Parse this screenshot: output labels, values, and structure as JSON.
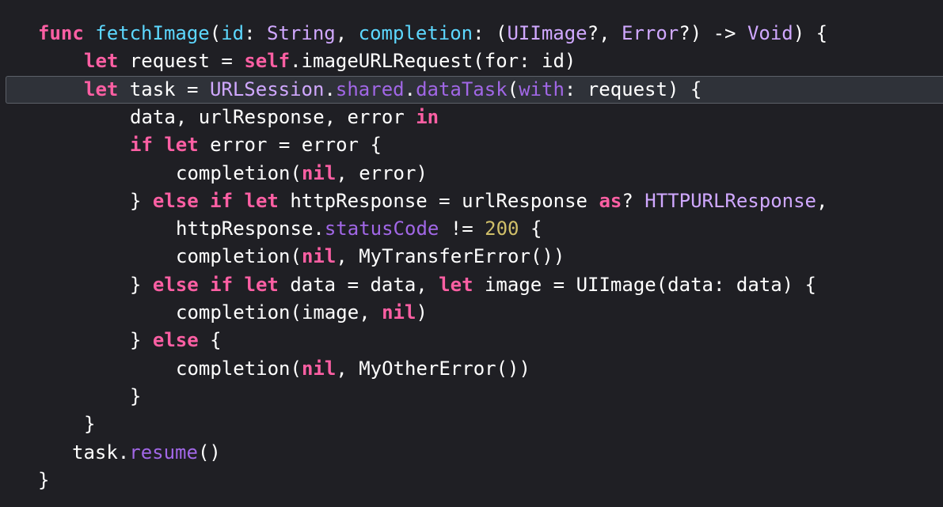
{
  "editor": {
    "language": "swift",
    "current_line": 2,
    "colors": {
      "background": "#1f1f24",
      "current_line": "#2f3239",
      "keyword": "#fc5fa3",
      "declaration": "#5dd8ff",
      "type": "#d0a8ff",
      "property": "#a167e6",
      "number": "#d0bf69",
      "plain": "#ffffff"
    },
    "lines": [
      {
        "indent": 0,
        "tokens": [
          {
            "t": "func",
            "k": "kw"
          },
          {
            "t": " ",
            "k": "pl"
          },
          {
            "t": "fetchImage",
            "k": "fn"
          },
          {
            "t": "(",
            "k": "pl"
          },
          {
            "t": "id",
            "k": "fn"
          },
          {
            "t": ": ",
            "k": "pl"
          },
          {
            "t": "String",
            "k": "typ"
          },
          {
            "t": ", ",
            "k": "pl"
          },
          {
            "t": "completion",
            "k": "fn"
          },
          {
            "t": ": (",
            "k": "pl"
          },
          {
            "t": "UIImage",
            "k": "typ"
          },
          {
            "t": "?, ",
            "k": "pl"
          },
          {
            "t": "Error",
            "k": "typ"
          },
          {
            "t": "?) -> ",
            "k": "pl"
          },
          {
            "t": "Void",
            "k": "typ"
          },
          {
            "t": ") {",
            "k": "pl"
          }
        ]
      },
      {
        "indent": 1,
        "tokens": [
          {
            "t": "let",
            "k": "kw"
          },
          {
            "t": " request = ",
            "k": "pl"
          },
          {
            "t": "self",
            "k": "kw"
          },
          {
            "t": ".imageURLRequest(for: id)",
            "k": "pl"
          }
        ]
      },
      {
        "indent": 1,
        "tokens": [
          {
            "t": "let",
            "k": "kw"
          },
          {
            "t": " task = ",
            "k": "pl"
          },
          {
            "t": "URLSession",
            "k": "typ"
          },
          {
            "t": ".",
            "k": "pl"
          },
          {
            "t": "shared",
            "k": "prop"
          },
          {
            "t": ".",
            "k": "pl"
          },
          {
            "t": "dataTask",
            "k": "prop"
          },
          {
            "t": "(",
            "k": "pl"
          },
          {
            "t": "with",
            "k": "prop"
          },
          {
            "t": ": request) {",
            "k": "pl"
          }
        ]
      },
      {
        "indent": 2,
        "tokens": [
          {
            "t": "data, urlResponse, error ",
            "k": "pl"
          },
          {
            "t": "in",
            "k": "kw"
          }
        ]
      },
      {
        "indent": 2,
        "tokens": [
          {
            "t": "if",
            "k": "kw"
          },
          {
            "t": " ",
            "k": "pl"
          },
          {
            "t": "let",
            "k": "kw"
          },
          {
            "t": " error = error {",
            "k": "pl"
          }
        ]
      },
      {
        "indent": 3,
        "tokens": [
          {
            "t": "completion(",
            "k": "pl"
          },
          {
            "t": "nil",
            "k": "kw"
          },
          {
            "t": ", error)",
            "k": "pl"
          }
        ]
      },
      {
        "indent": 2,
        "tokens": [
          {
            "t": "} ",
            "k": "pl"
          },
          {
            "t": "else",
            "k": "kw"
          },
          {
            "t": " ",
            "k": "pl"
          },
          {
            "t": "if",
            "k": "kw"
          },
          {
            "t": " ",
            "k": "pl"
          },
          {
            "t": "let",
            "k": "kw"
          },
          {
            "t": " httpResponse = urlResponse ",
            "k": "pl"
          },
          {
            "t": "as",
            "k": "kw"
          },
          {
            "t": "? ",
            "k": "pl"
          },
          {
            "t": "HTTPURLResponse",
            "k": "typ"
          },
          {
            "t": ",",
            "k": "pl"
          }
        ]
      },
      {
        "indent": 3,
        "tokens": [
          {
            "t": "httpResponse.",
            "k": "pl"
          },
          {
            "t": "statusCode",
            "k": "prop"
          },
          {
            "t": " != ",
            "k": "pl"
          },
          {
            "t": "200",
            "k": "num"
          },
          {
            "t": " {",
            "k": "pl"
          }
        ]
      },
      {
        "indent": 3,
        "tokens": [
          {
            "t": "completion(",
            "k": "pl"
          },
          {
            "t": "nil",
            "k": "kw"
          },
          {
            "t": ", MyTransferError())",
            "k": "pl"
          }
        ]
      },
      {
        "indent": 2,
        "tokens": [
          {
            "t": "} ",
            "k": "pl"
          },
          {
            "t": "else",
            "k": "kw"
          },
          {
            "t": " ",
            "k": "pl"
          },
          {
            "t": "if",
            "k": "kw"
          },
          {
            "t": " ",
            "k": "pl"
          },
          {
            "t": "let",
            "k": "kw"
          },
          {
            "t": " data = data, ",
            "k": "pl"
          },
          {
            "t": "let",
            "k": "kw"
          },
          {
            "t": " image = UIImage(data: data) {",
            "k": "pl"
          }
        ]
      },
      {
        "indent": 3,
        "tokens": [
          {
            "t": "completion(image, ",
            "k": "pl"
          },
          {
            "t": "nil",
            "k": "kw"
          },
          {
            "t": ")",
            "k": "pl"
          }
        ]
      },
      {
        "indent": 2,
        "tokens": [
          {
            "t": "} ",
            "k": "pl"
          },
          {
            "t": "else",
            "k": "kw"
          },
          {
            "t": " {",
            "k": "pl"
          }
        ]
      },
      {
        "indent": 3,
        "tokens": [
          {
            "t": "completion(",
            "k": "pl"
          },
          {
            "t": "nil",
            "k": "kw"
          },
          {
            "t": ", MyOtherError())",
            "k": "pl"
          }
        ]
      },
      {
        "indent": 2,
        "tokens": [
          {
            "t": "}",
            "k": "pl"
          }
        ]
      },
      {
        "indent": 1,
        "tokens": [
          {
            "t": "}",
            "k": "pl"
          }
        ]
      },
      {
        "indent": 1,
        "tokens": [
          {
            "t": "task.",
            "k": "pl"
          },
          {
            "t": "resume",
            "k": "prop"
          },
          {
            "t": "()",
            "k": "pl"
          }
        ]
      },
      {
        "indent": 0,
        "tokens": [
          {
            "t": "}",
            "k": "pl"
          }
        ]
      }
    ]
  }
}
